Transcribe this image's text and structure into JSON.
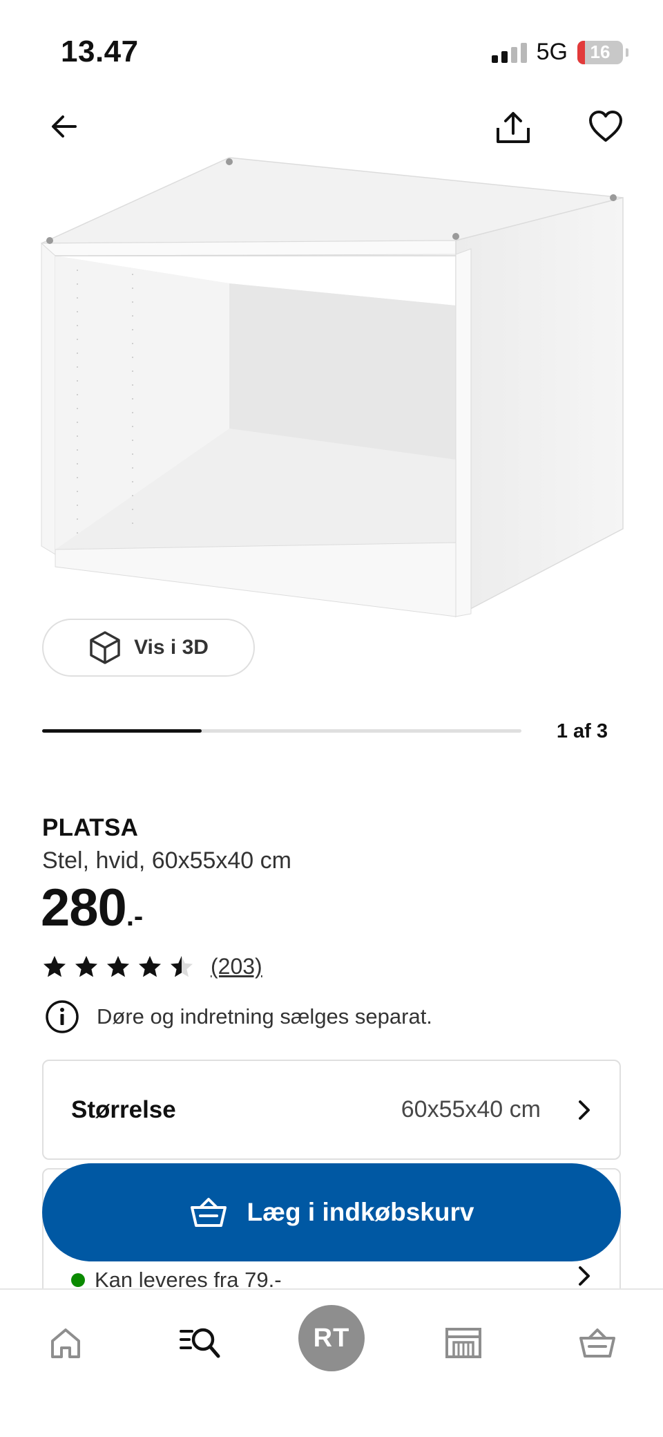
{
  "status_bar": {
    "time": "13.47",
    "network": "5G",
    "battery": "16",
    "battery_fraction": 0.16
  },
  "top_nav": {
    "back_icon": "arrow-left-icon",
    "share_icon": "share-icon",
    "favorite_icon": "heart-icon"
  },
  "gallery": {
    "view_3d_label": "Vis i 3D",
    "view_3d_icon": "cube-icon",
    "counter": "1 af 3",
    "progress_fraction": 0.3333
  },
  "product": {
    "name": "PLATSA",
    "description": "Stel, hvid, 60x55x40 cm",
    "price": "280",
    "price_suffix": ".-",
    "rating": 4.5,
    "rating_count": "(203)",
    "notice_icon": "info-icon",
    "notice": "Døre og indretning sælges separat."
  },
  "size_selector": {
    "label": "Størrelse",
    "value": "60x55x40 cm"
  },
  "delivery": {
    "text": "Kan leveres fra 79.-"
  },
  "cart_button": {
    "label": "Læg i indkøbskurv",
    "icon": "basket-icon",
    "color": "#0058a3"
  },
  "tab_bar": {
    "home_icon": "home-icon",
    "search_icon": "search-list-icon",
    "profile_initials": "RT",
    "store_icon": "store-icon",
    "cart_icon": "basket-icon"
  }
}
